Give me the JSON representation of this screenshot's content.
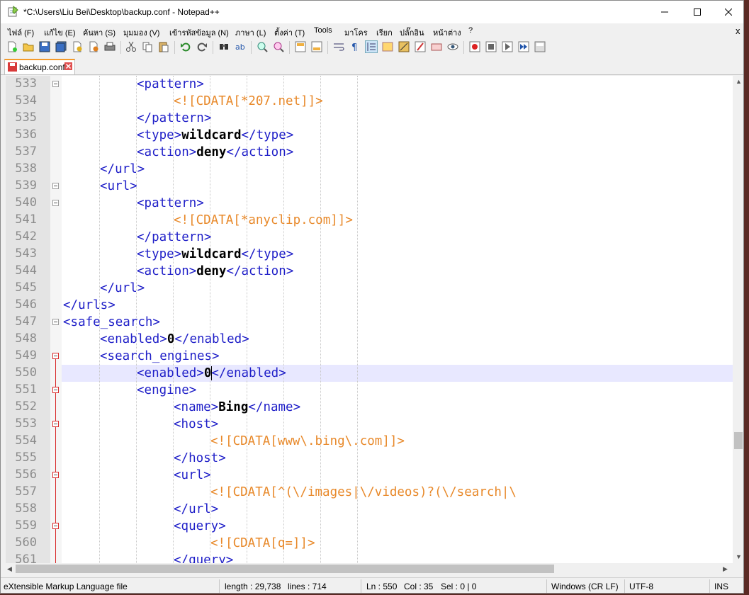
{
  "window": {
    "title": "*C:\\Users\\Liu Bei\\Desktop\\backup.conf - Notepad++"
  },
  "menu": [
    "ไฟล์ (F)",
    "แก้ไข (E)",
    "ค้นหา (S)",
    "มุมมอง (V)",
    "เข้ารหัสข้อมูล (N)",
    "ภาษา (L)",
    "ตั้งค่า (T)",
    "Tools",
    "มาโคร",
    "เรียก",
    "ปลั๊กอิน",
    "หน้าต่าง",
    "?"
  ],
  "menu_close": "x",
  "tab": {
    "label": "backup.conf"
  },
  "editor": {
    "lines": [
      {
        "n": "533",
        "code": [
          {
            "t": "<pattern>",
            "c": "tag"
          }
        ]
      },
      {
        "n": "534",
        "code": [
          {
            "t": "<![CDATA[*207.net]]>",
            "c": "cdata"
          }
        ]
      },
      {
        "n": "535",
        "code": [
          {
            "t": "</pattern>",
            "c": "tag"
          }
        ]
      },
      {
        "n": "536",
        "code": [
          {
            "t": "<type>",
            "c": "tag"
          },
          {
            "t": "wildcard",
            "c": "txt"
          },
          {
            "t": "</type>",
            "c": "tag"
          }
        ]
      },
      {
        "n": "537",
        "code": [
          {
            "t": "<action>",
            "c": "tag"
          },
          {
            "t": "deny",
            "c": "txt"
          },
          {
            "t": "</action>",
            "c": "tag"
          }
        ]
      },
      {
        "n": "538",
        "code": [
          {
            "t": "</url>",
            "c": "tag"
          }
        ]
      },
      {
        "n": "539",
        "code": [
          {
            "t": "<url>",
            "c": "tag"
          }
        ]
      },
      {
        "n": "540",
        "code": [
          {
            "t": "<pattern>",
            "c": "tag"
          }
        ]
      },
      {
        "n": "541",
        "code": [
          {
            "t": "<![CDATA[*anyclip.com]]>",
            "c": "cdata"
          }
        ]
      },
      {
        "n": "542",
        "code": [
          {
            "t": "</pattern>",
            "c": "tag"
          }
        ]
      },
      {
        "n": "543",
        "code": [
          {
            "t": "<type>",
            "c": "tag"
          },
          {
            "t": "wildcard",
            "c": "txt"
          },
          {
            "t": "</type>",
            "c": "tag"
          }
        ]
      },
      {
        "n": "544",
        "code": [
          {
            "t": "<action>",
            "c": "tag"
          },
          {
            "t": "deny",
            "c": "txt"
          },
          {
            "t": "</action>",
            "c": "tag"
          }
        ]
      },
      {
        "n": "545",
        "code": [
          {
            "t": "</url>",
            "c": "tag"
          }
        ]
      },
      {
        "n": "546",
        "code": [
          {
            "t": "</urls>",
            "c": "tag"
          }
        ]
      },
      {
        "n": "547",
        "code": [
          {
            "t": "<safe_search>",
            "c": "tag"
          }
        ]
      },
      {
        "n": "548",
        "code": [
          {
            "t": "<enabled>",
            "c": "tag"
          },
          {
            "t": "0",
            "c": "txt"
          },
          {
            "t": "</enabled>",
            "c": "tag"
          }
        ]
      },
      {
        "n": "549",
        "code": [
          {
            "t": "<search_engines>",
            "c": "tag"
          }
        ]
      },
      {
        "n": "550",
        "code": [
          {
            "t": "<enabled>",
            "c": "tag"
          },
          {
            "t": "0",
            "c": "txt"
          },
          {
            "t": "</enabled>",
            "c": "tag"
          }
        ]
      },
      {
        "n": "551",
        "code": [
          {
            "t": "<engine>",
            "c": "tag"
          }
        ]
      },
      {
        "n": "552",
        "code": [
          {
            "t": "<name>",
            "c": "tag"
          },
          {
            "t": "Bing",
            "c": "txt"
          },
          {
            "t": "</name>",
            "c": "tag"
          }
        ]
      },
      {
        "n": "553",
        "code": [
          {
            "t": "<host>",
            "c": "tag"
          }
        ]
      },
      {
        "n": "554",
        "code": [
          {
            "t": "<![CDATA[www\\.bing\\.com]]>",
            "c": "cdata"
          }
        ]
      },
      {
        "n": "555",
        "code": [
          {
            "t": "</host>",
            "c": "tag"
          }
        ]
      },
      {
        "n": "556",
        "code": [
          {
            "t": "<url>",
            "c": "tag"
          }
        ]
      },
      {
        "n": "557",
        "code": [
          {
            "t": "<![CDATA[^(\\/images|\\/videos)?(\\/search|\\",
            "c": "cdata"
          }
        ]
      },
      {
        "n": "558",
        "code": [
          {
            "t": "</url>",
            "c": "tag"
          }
        ]
      },
      {
        "n": "559",
        "code": [
          {
            "t": "<query>",
            "c": "tag"
          }
        ]
      },
      {
        "n": "560",
        "code": [
          {
            "t": "<![CDATA[q=]]>",
            "c": "cdata"
          }
        ]
      },
      {
        "n": "561",
        "code": [
          {
            "t": "</query>",
            "c": "tag"
          }
        ]
      }
    ]
  },
  "status": {
    "filetype": "eXtensible Markup Language file",
    "length": "length : 29,738",
    "lines": "lines : 714",
    "ln": "Ln : 550",
    "col": "Col : 35",
    "sel": "Sel : 0 | 0",
    "eol": "Windows (CR LF)",
    "encoding": "UTF-8",
    "mode": "INS"
  },
  "colors": {
    "tag": "#1f1fc8",
    "cdata": "#e8892a",
    "text": "#000000",
    "caret_line": "#e8e8ff",
    "fold": "#d82a2a"
  }
}
